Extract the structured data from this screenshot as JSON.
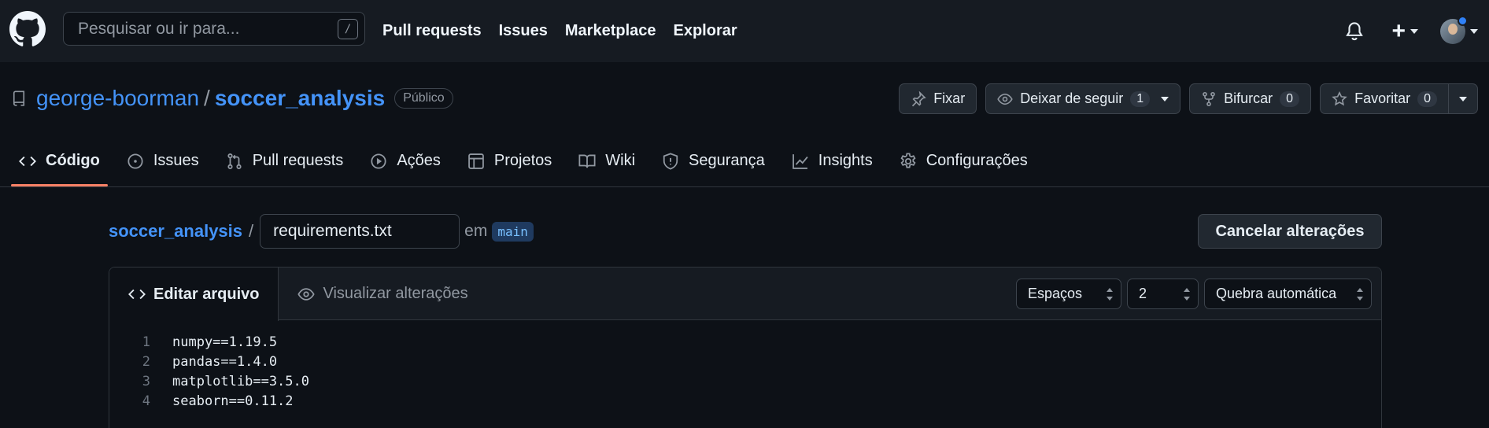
{
  "header": {
    "search_placeholder": "Pesquisar ou ir para...",
    "search_shortcut": "/",
    "nav": [
      "Pull requests",
      "Issues",
      "Marketplace",
      "Explorar"
    ],
    "create_label": "+"
  },
  "repo": {
    "owner": "george-boorman",
    "separator": "/",
    "name": "soccer_analysis",
    "visibility": "Público",
    "actions": {
      "pin_label": "Fixar",
      "watch_label": "Deixar de seguir",
      "watch_count": "1",
      "fork_label": "Bifurcar",
      "fork_count": "0",
      "star_label": "Favoritar",
      "star_count": "0"
    }
  },
  "tabs": [
    {
      "label": "Código",
      "icon": "code-icon",
      "active": true
    },
    {
      "label": "Issues",
      "icon": "issue-icon"
    },
    {
      "label": "Pull requests",
      "icon": "pull-request-icon"
    },
    {
      "label": "Ações",
      "icon": "play-icon"
    },
    {
      "label": "Projetos",
      "icon": "table-icon"
    },
    {
      "label": "Wiki",
      "icon": "book-icon"
    },
    {
      "label": "Segurança",
      "icon": "shield-icon"
    },
    {
      "label": "Insights",
      "icon": "graph-icon"
    },
    {
      "label": "Configurações",
      "icon": "gear-icon"
    }
  ],
  "editor": {
    "repo_link": "soccer_analysis",
    "separator": "/",
    "filename": "requirements.txt",
    "in_label": "em",
    "branch": "main",
    "cancel_label": "Cancelar alterações",
    "edit_tab": "Editar arquivo",
    "preview_tab": "Visualizar alterações",
    "indent_mode": "Espaços",
    "indent_size": "2",
    "wrap_mode": "Quebra automática",
    "lines": [
      {
        "n": "1",
        "text": "numpy==1.19.5"
      },
      {
        "n": "2",
        "text": "pandas==1.4.0"
      },
      {
        "n": "3",
        "text": "matplotlib==3.5.0"
      },
      {
        "n": "4",
        "text": "seaborn==0.11.2"
      }
    ]
  },
  "colors": {
    "bg": "#0d1117",
    "header_bg": "#161b22",
    "link": "#4493f8",
    "active_tab_underline": "#f78166",
    "notification_dot": "#2f81f7"
  }
}
